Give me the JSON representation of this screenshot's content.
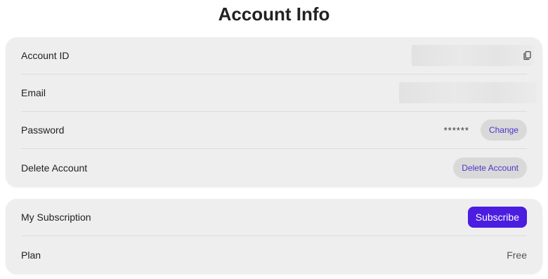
{
  "page": {
    "title": "Account Info"
  },
  "account": {
    "id_label": "Account ID",
    "email_label": "Email",
    "password_label": "Password",
    "password_mask": "******",
    "change_button": "Change",
    "delete_label": "Delete Account",
    "delete_button": "Delete Account",
    "icons": {
      "copy": "copy-icon"
    }
  },
  "subscription": {
    "label": "My Subscription",
    "subscribe_button": "Subscribe",
    "plan_label": "Plan",
    "plan_value": "Free"
  },
  "colors": {
    "accent": "#4a1de0",
    "link_text": "#4a36c8",
    "card_background": "#eeeeee",
    "button_light": "#d9d9d9"
  }
}
